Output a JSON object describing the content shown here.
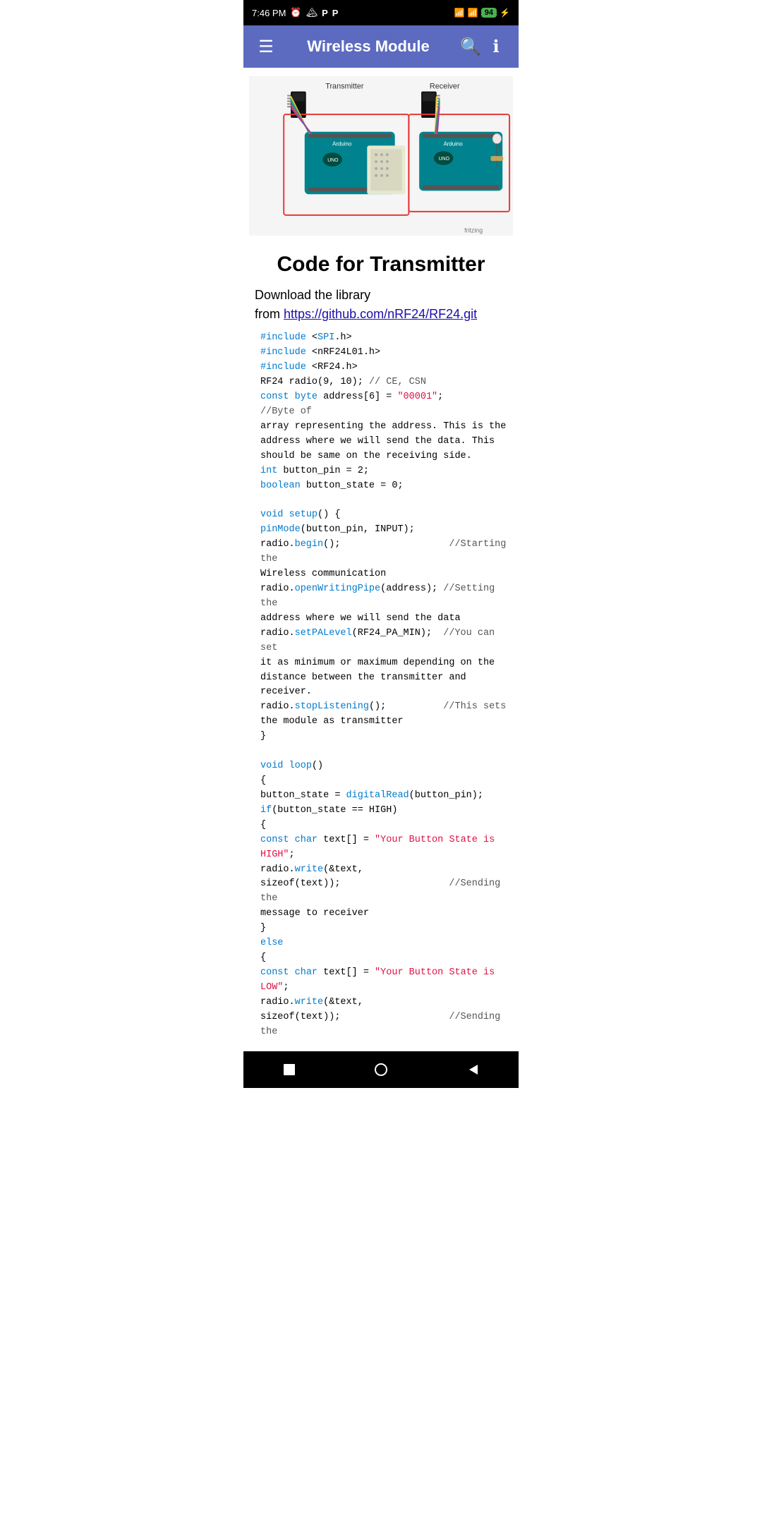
{
  "statusBar": {
    "time": "7:46 PM",
    "battery": "94",
    "batterySymbol": "⚡"
  },
  "appBar": {
    "title": "Wireless Module",
    "menuIcon": "☰",
    "searchIcon": "🔍",
    "infoIcon": "ℹ"
  },
  "diagram": {
    "altText": "Arduino Transmitter and Receiver wiring diagram with NRF24L01 wireless modules"
  },
  "section": {
    "heading": "Code for Transmitter"
  },
  "libraryText": {
    "line1": "Download the library",
    "line2": "from ",
    "link": "https://github.com/nRF24/RF24.git"
  },
  "code": {
    "full": "#include <SPI.h>\n#include <nRF24L01.h>\n#include <RF24.h>\nRF24 radio(9, 10); // CE, CSN\nconst byte address[6] = \"00001\";      //Byte of\narray representing the address. This is the\naddress where we will send the data. This\nshould be same on the receiving side.\nint button_pin = 2;\nboolean button_state = 0;\n\nvoid setup() {\npinMode(button_pin, INPUT);\nradio.begin();                   //Starting the\nWireless communication\nradio.openWritingPipe(address); //Setting the\naddress where we will send the data\nradio.setPALevel(RF24_PA_MIN);  //You can set\nit as minimum or maximum depending on the\ndistance between the transmitter and receiver.\nradio.stopListening();          //This sets\nthe module as transmitter\n}\n\nvoid loop()\n{\nbutton_state = digitalRead(button_pin);\nif(button_state == HIGH)\n{\nconst char text[] = \"Your Button State is\nHIGH\";\nradio.write(&text,\nsizeof(text));                   //Sending the\nmessage to receiver\n}\nelse\n{\nconst char text[] = \"Your Button State is\nLOW\";\nradio.write(&text,\nsizeof(text));                   //Sending the"
  }
}
